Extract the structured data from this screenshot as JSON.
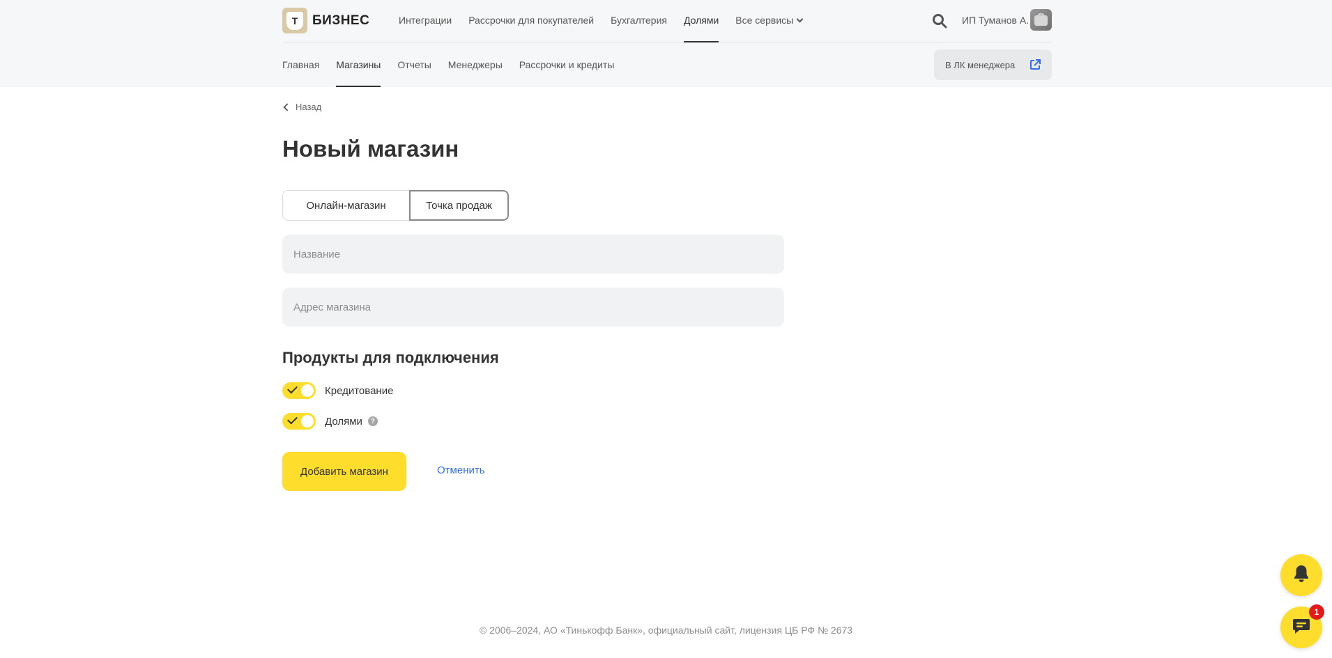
{
  "header": {
    "logo_text": "БИЗНЕС",
    "logo_letter": "Т",
    "nav": [
      {
        "label": "Интеграции"
      },
      {
        "label": "Рассрочки для покупателей"
      },
      {
        "label": "Бухгалтерия"
      },
      {
        "label": "Долями"
      },
      {
        "label": "Все сервисы"
      }
    ],
    "active_nav": "Долями",
    "user_name": "ИП Туманов А."
  },
  "subnav": {
    "items": [
      {
        "label": "Главная"
      },
      {
        "label": "Магазины"
      },
      {
        "label": "Отчеты"
      },
      {
        "label": "Менеджеры"
      },
      {
        "label": "Рассрочки и кредиты"
      }
    ],
    "active": "Магазины",
    "manager_button": "В ЛК менеджера"
  },
  "page": {
    "back_label": "Назад",
    "title": "Новый магазин",
    "segments": [
      {
        "label": "Онлайн-магазин"
      },
      {
        "label": "Точка продаж"
      }
    ],
    "selected_segment": "Точка продаж",
    "fields": {
      "name": {
        "placeholder": "Название",
        "value": ""
      },
      "address": {
        "placeholder": "Адрес магазина",
        "value": ""
      }
    },
    "products_title": "Продукты для подключения",
    "products": [
      {
        "label": "Кредитование",
        "enabled": true
      },
      {
        "label": "Долями",
        "enabled": true,
        "help": "?"
      }
    ],
    "submit_label": "Добавить магазин",
    "cancel_label": "Отменить"
  },
  "footer": {
    "text": "© 2006–2024, АО «Тинькофф Банк», официальный сайт, лицензия ЦБ РФ № 2673"
  },
  "widgets": {
    "chat_badge": "1"
  },
  "colors": {
    "accent": "#ffdd2d",
    "link": "#336fee",
    "badge": "#e21a1a"
  },
  "icons": [
    "search-icon",
    "external-link-icon",
    "chevron-left-icon",
    "chevron-down-icon",
    "check-icon",
    "help-icon",
    "bell-icon",
    "chat-icon"
  ]
}
